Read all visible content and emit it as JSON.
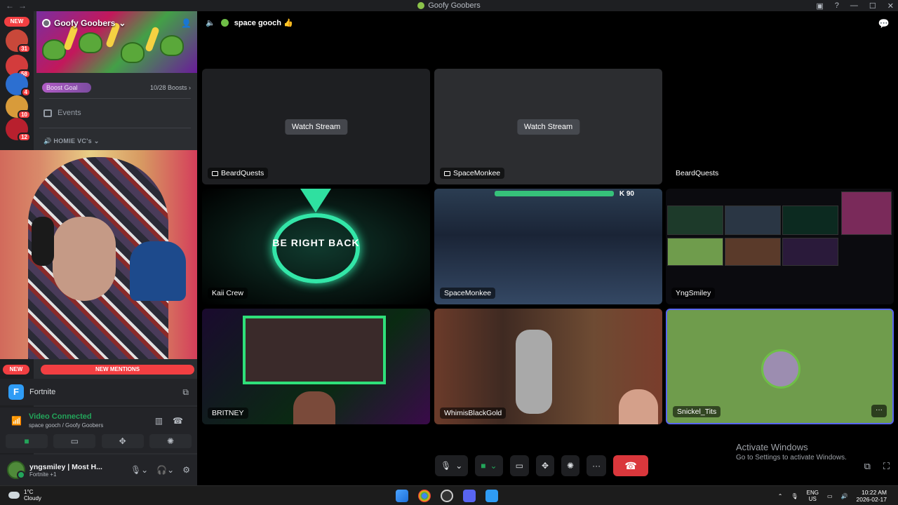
{
  "window": {
    "title": "Goofy Goobers"
  },
  "servers": {
    "new_label": "NEW",
    "badges": [
      "31",
      "58",
      "4",
      "10",
      "12"
    ]
  },
  "server": {
    "name": "Goofy Goobers",
    "boost_label": "Boost Goal",
    "boost_count": "10/28 Boosts",
    "boost_progress": 0.357,
    "events_label": "Events",
    "category": "HOMIE VC's"
  },
  "banners": {
    "new": "NEW",
    "mentions": "NEW MENTIONS"
  },
  "activity": {
    "game": "Fortnite"
  },
  "voice": {
    "status": "Video Connected",
    "channel": "space gooch",
    "server": "Goofy Goobers"
  },
  "user": {
    "name": "yngsmiley | Most H...",
    "status": "Fortnite +1"
  },
  "stage": {
    "channel": "space gooch",
    "watch_stream": "Watch Stream",
    "tiles": [
      {
        "name": "BeardQuests"
      },
      {
        "name": "SpaceMonkee"
      },
      {
        "name": "BeardQuests"
      },
      {
        "name": "Kaii Crew",
        "brb": "BE RIGHT BACK"
      },
      {
        "name": "SpaceMonkee",
        "score": "90"
      },
      {
        "name": "YngSmiley"
      },
      {
        "name": "BRITNEY"
      },
      {
        "name": "WhimisBlackGold"
      },
      {
        "name": "Snickel_Tits"
      }
    ]
  },
  "activation": {
    "title": "Activate Windows",
    "subtitle": "Go to Settings to activate Windows."
  },
  "taskbar": {
    "temp": "1°C",
    "weather": "Cloudy",
    "lang1": "ENG",
    "lang2": "US",
    "time": "10:22 AM",
    "date": "2026-02-17"
  }
}
